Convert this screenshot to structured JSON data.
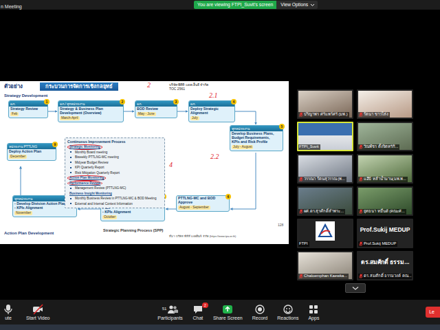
{
  "window": {
    "title": "n Meeting"
  },
  "banner": {
    "text": "You are viewing FTPI_Suvit's screen",
    "view_options": "View Options"
  },
  "slide": {
    "label": "ตัวอย่าง",
    "title": "กระบวนการจัดการเชิงกลยุทธ์",
    "company": "บริษัท พีทีที แอลเอ็นจี จำกัด",
    "company_sub": "TOC 2561",
    "sections": [
      "Strategy Development",
      "Action Plan Development"
    ],
    "process_name": "Strategic Planning Process (SPP)",
    "page": "128",
    "source": "ที่มา: บริษัท พีทีที แอลเอ็นจี จำกัด (https://www.tpa.or.th)",
    "annotations": [
      "2",
      "2.1",
      "2.2",
      "4"
    ],
    "steps": [
      {
        "number": "1",
        "owner": "ผภ.",
        "title": "Strategy Review",
        "period": "Feb"
      },
      {
        "number": "2",
        "owner": "ผภ./ ทุกหน่วยงาน",
        "title": "Strategy & Business Plan Development (Overview)",
        "period": "March-April"
      },
      {
        "number": "3",
        "owner": "ผภ.",
        "title": "BOD Review",
        "period": "May - June"
      },
      {
        "number": "4",
        "owner": "ผภ.",
        "title": "Deploy Strategic Alignment",
        "period": "July"
      },
      {
        "number": "5",
        "owner": "ทุกหน่วยงาน",
        "title": "Develop Business Plans, Budget Requirements, KPIs and Risk Profile",
        "period": "July - August"
      },
      {
        "number": "6",
        "title": "PTTLNG-MC and BOD Approve",
        "period": "August - September"
      },
      {
        "number": "7",
        "owner": "ทุกหน่วยงาน",
        "title": "- Develop Department Action Plan\n- KPIs Alignment",
        "period": "October"
      },
      {
        "number": "8",
        "owner": "ทุกหน่วยงาน",
        "title": "- Develop Division Action Plan\n- KPIs Alignment",
        "period": "November"
      },
      {
        "number": "9",
        "owner": "หน่วยงาน PTTLNG",
        "title": "Deploy Action Plan",
        "period": "December"
      }
    ],
    "center": {
      "title": "Continuous Improvement Process",
      "lines": [
        {
          "text": "Strategic Monitoring",
          "kind": "heading",
          "circled": true
        },
        {
          "text": "Monthly Board meeting",
          "kind": "item",
          "circled": false
        },
        {
          "text": "Biweekly PTTLNG-MC meeting",
          "kind": "item",
          "circled": false
        },
        {
          "text": "Midyear Budget Review",
          "kind": "item",
          "circled": false
        },
        {
          "text": "KPI Quarterly Report",
          "kind": "item",
          "circled": false
        },
        {
          "text": "Risk Mitigation Quarterly Report",
          "kind": "item",
          "circled": false
        },
        {
          "text": "Action Plan Monitoring",
          "kind": "heading",
          "circled": true
        },
        {
          "text": "Performance Review",
          "kind": "heading",
          "circled": true
        },
        {
          "text": "Management Review (PTTLNG-MC)",
          "kind": "item",
          "circled": false
        },
        {
          "text": "Business Insight Monitoring",
          "kind": "heading",
          "circled": false
        },
        {
          "text": "Monthly Business Review in PTTLNG-MC & BOD Meeting",
          "kind": "item",
          "circled": false
        },
        {
          "text": "External and Internal Context Information",
          "kind": "item",
          "circled": false
        }
      ]
    }
  },
  "participants": [
    {
      "name": "ปริญาพร ศรีแพร์ศรี (มพ.)",
      "kind": "video",
      "muted": true,
      "speaking": false
    },
    {
      "name": "รัตนา ขาวใส่ง",
      "kind": "video",
      "muted": true,
      "speaking": false
    },
    {
      "name": "FTPI_Suvit",
      "kind": "video",
      "muted": false,
      "speaking": true
    },
    {
      "name": "วีณพัชร ตั้งจิตหรีกิ...",
      "kind": "video",
      "muted": true,
      "speaking": false
    },
    {
      "name": "วรรณา รัตนสุวรรณ (พ...",
      "kind": "video",
      "muted": true,
      "speaking": false
    },
    {
      "name": "แอ๊ปี หล้าน้ำมาน(มพ.พ...",
      "kind": "video",
      "muted": true,
      "speaking": false
    },
    {
      "name": "ผศ.ดร.สุรศักดิ์ลำพระ...",
      "kind": "video",
      "muted": true,
      "speaking": false
    },
    {
      "name": "ยุทธนา หมื่นดี (คณะศ...",
      "kind": "video",
      "muted": true,
      "speaking": false
    },
    {
      "name": "FTPI",
      "kind": "logo",
      "muted": false,
      "speaking": false
    },
    {
      "name": "Prof.Sukij MEDUP",
      "kind": "name",
      "display": "Prof.Sukij MEDUP",
      "muted": true,
      "speaking": false
    },
    {
      "name": "Chaloemphan Kaewka...",
      "kind": "video",
      "muted": true,
      "speaking": false
    },
    {
      "name": "ดร.สมศักดิ์ ธรรมวงค์ คณ...",
      "kind": "name",
      "display": "ดร.สมศักดิ์ ธรรม...",
      "muted": true,
      "speaking": false
    }
  ],
  "toolbar": {
    "items": [
      {
        "label": "ute",
        "kind": "mic",
        "off": false
      },
      {
        "label": "Start Video",
        "kind": "video",
        "off": true
      },
      {
        "label": "Participants",
        "kind": "participants",
        "count": "51",
        "off": false
      },
      {
        "label": "Chat",
        "kind": "chat",
        "badge": "2",
        "off": false
      },
      {
        "label": "Share Screen",
        "kind": "share",
        "off": false
      },
      {
        "label": "Record",
        "kind": "record",
        "off": false
      },
      {
        "label": "Reactions",
        "kind": "reactions",
        "off": false
      },
      {
        "label": "Apps",
        "kind": "apps",
        "off": false
      }
    ],
    "leave": "Le"
  }
}
